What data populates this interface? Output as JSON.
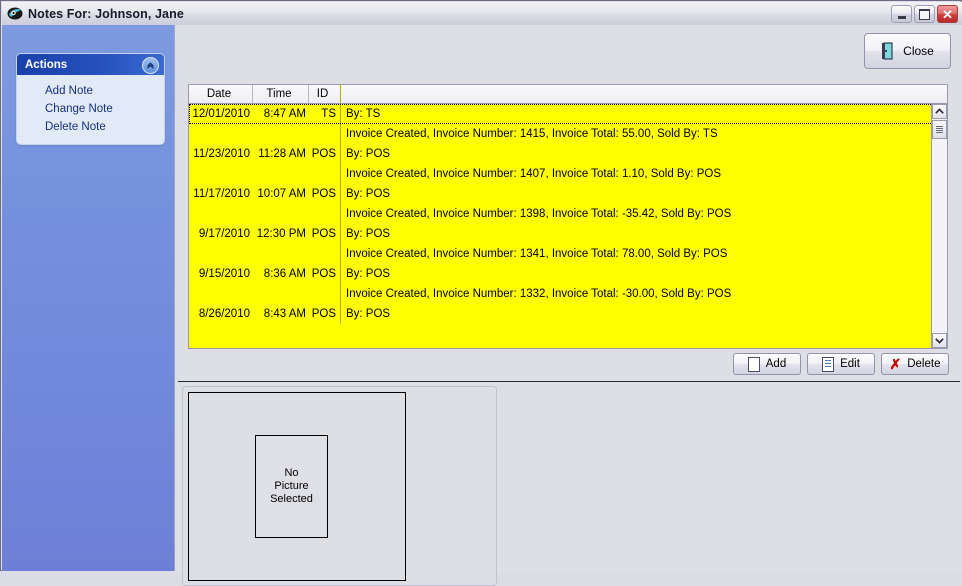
{
  "window": {
    "title": "Notes For: Johnson, Jane",
    "icon": "app-swoosh-icon",
    "controls": {
      "minimize": "–",
      "maximize": "□",
      "close": "✕"
    }
  },
  "sidebar": {
    "panel_title": "Actions",
    "collapse_glyph": "«",
    "items": [
      {
        "label": "Add Note"
      },
      {
        "label": "Change Note"
      },
      {
        "label": "Delete Note"
      }
    ]
  },
  "toolbar": {
    "close_label": "Close",
    "close_icon": "exit-door-icon"
  },
  "grid": {
    "columns": [
      "Date",
      "Time",
      "ID",
      ""
    ],
    "rows": [
      {
        "type": "header",
        "selected": true,
        "date": "12/01/2010",
        "time": "8:47 AM",
        "id": "TS",
        "note": "By: TS"
      },
      {
        "type": "detail",
        "selected": false,
        "date": "",
        "time": "",
        "id": "",
        "note": "Invoice Created, Invoice Number: 1415, Invoice Total: 55.00, Sold By: TS"
      },
      {
        "type": "header",
        "selected": false,
        "date": "11/23/2010",
        "time": "11:28 AM",
        "id": "POS",
        "note": "By: POS"
      },
      {
        "type": "detail",
        "selected": false,
        "date": "",
        "time": "",
        "id": "",
        "note": "Invoice Created, Invoice Number: 1407, Invoice Total: 1.10, Sold By: POS"
      },
      {
        "type": "header",
        "selected": false,
        "date": "11/17/2010",
        "time": "10:07 AM",
        "id": "POS",
        "note": "By: POS"
      },
      {
        "type": "detail",
        "selected": false,
        "date": "",
        "time": "",
        "id": "",
        "note": "Invoice Created, Invoice Number: 1398, Invoice Total: -35.42, Sold By: POS"
      },
      {
        "type": "header",
        "selected": false,
        "date": "9/17/2010",
        "time": "12:30 PM",
        "id": "POS",
        "note": "By: POS"
      },
      {
        "type": "detail",
        "selected": false,
        "date": "",
        "time": "",
        "id": "",
        "note": "Invoice Created, Invoice Number: 1341, Invoice Total: 78.00, Sold By: POS"
      },
      {
        "type": "header",
        "selected": false,
        "date": "9/15/2010",
        "time": "8:36 AM",
        "id": "POS",
        "note": "By: POS"
      },
      {
        "type": "detail",
        "selected": false,
        "date": "",
        "time": "",
        "id": "",
        "note": "Invoice Created, Invoice Number: 1332, Invoice Total: -30.00, Sold By: POS"
      },
      {
        "type": "header",
        "selected": false,
        "date": "8/26/2010",
        "time": "8:43 AM",
        "id": "POS",
        "note": "By: POS"
      }
    ],
    "scrollbar": {
      "up_glyph": "▲",
      "down_glyph": "▼"
    }
  },
  "grid_buttons": [
    {
      "label": "Add",
      "icon": "new-page-icon"
    },
    {
      "label": "Edit",
      "icon": "lined-page-icon"
    },
    {
      "label": "Delete",
      "icon": "red-x-icon"
    }
  ],
  "picture": {
    "placeholder_lines": [
      "No",
      "Picture",
      "Selected"
    ]
  },
  "colors": {
    "sidebar_blue": "#7490dc",
    "panel_header_blue": "#1b41ab",
    "grid_yellow": "#ffff00",
    "window_bg": "#dedee5",
    "delete_red": "#c00000"
  }
}
